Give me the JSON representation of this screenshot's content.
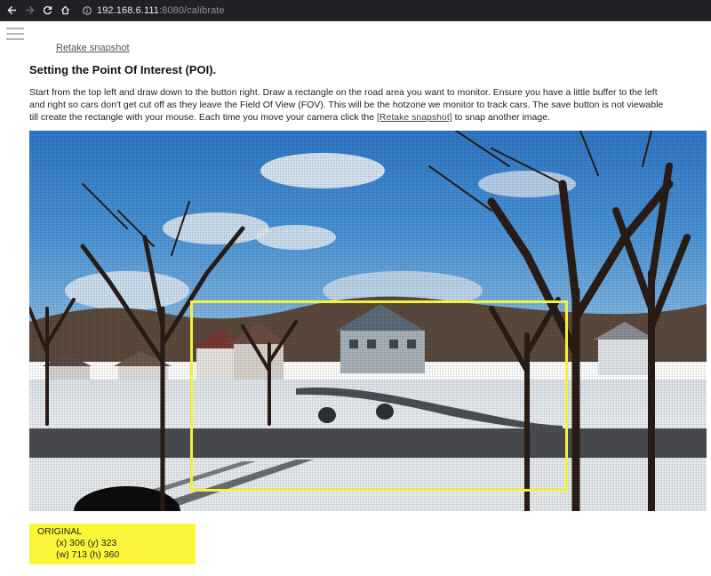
{
  "browser": {
    "url_host": "192.168.6.111",
    "url_rest": ":8080/calibrate"
  },
  "page": {
    "retake_link_top": "Retake snapshot",
    "title": "Setting the Point Of Interest (POI).",
    "instructions_part1": "Start from the top left and draw down to the button right. Draw a rectangle on the road area you want to monitor. Ensure you have a little buffer to the left and right so cars don't get cut off as they leave the Field Of View (FOV). This will be the hotzone we monitor to track cars. The save button is not viewable till create the rectangle with your mouse. Each time you move your camera click the ",
    "instructions_link": "[Retake snapshot]",
    "instructions_part2": " to snap another image."
  },
  "info_box": {
    "heading": "ORIGINAL",
    "line1": "(x) 306 (y) 323",
    "line2": "(w) 713 (h) 360"
  },
  "colors": {
    "poi_rect": "#f5f03a",
    "info_bg": "#fbf63a",
    "chrome_bg": "#202124"
  },
  "icons": {
    "back": "arrow-left-icon",
    "forward": "arrow-right-icon",
    "reload": "reload-icon",
    "home": "home-icon",
    "site_info": "info-icon",
    "menu": "hamburger-menu-icon"
  }
}
